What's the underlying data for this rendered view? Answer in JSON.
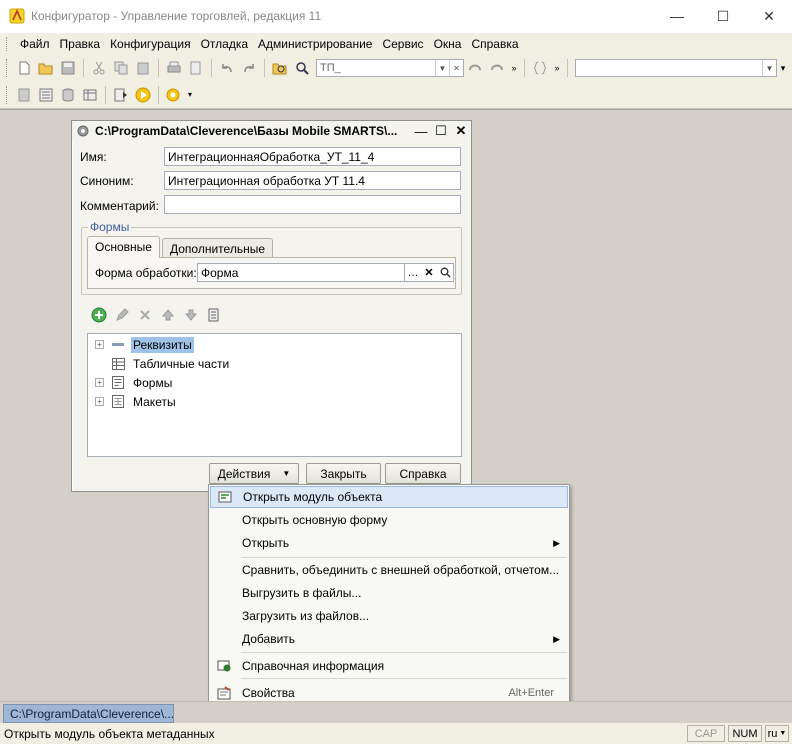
{
  "window": {
    "title": "Конфигуратор - Управление торговлей, редакция 11"
  },
  "menu": [
    "Файл",
    "Правка",
    "Конфигурация",
    "Отладка",
    "Администрирование",
    "Сервис",
    "Окна",
    "Справка"
  ],
  "toolbar": {
    "search_value": "ТП_"
  },
  "dialog": {
    "title": "C:\\ProgramData\\Cleverence\\Базы Mobile SMARTS\\...",
    "name_label": "Имя:",
    "name_value": "ИнтеграционнаяОбработка_УТ_11_4",
    "synonym_label": "Синоним:",
    "synonym_value": "Интеграционная обработка УТ 11.4",
    "comment_label": "Комментарий:",
    "comment_value": "",
    "forms_group_title": "Формы",
    "tabs": [
      "Основные",
      "Дополнительные"
    ],
    "form_label": "Форма обработки:",
    "form_value": "Форма",
    "tree": [
      {
        "label": "Реквизиты",
        "expand": "+",
        "selected": true
      },
      {
        "label": "Табличные части",
        "expand": "",
        "selected": false
      },
      {
        "label": "Формы",
        "expand": "+",
        "selected": false
      },
      {
        "label": "Макеты",
        "expand": "+",
        "selected": false
      }
    ],
    "actions_label": "Действия",
    "close_label": "Закрыть",
    "help_label": "Справка"
  },
  "context_menu": {
    "items": [
      {
        "label": "Открыть модуль объекта",
        "shortcut": "",
        "submenu": false,
        "icon": "module-icon"
      },
      {
        "label": "Открыть основную форму",
        "shortcut": "",
        "submenu": false,
        "icon": ""
      },
      {
        "label": "Открыть",
        "shortcut": "",
        "submenu": true,
        "icon": ""
      },
      {
        "label": "Сравнить, объединить с внешней обработкой, отчетом...",
        "shortcut": "",
        "submenu": false,
        "icon": ""
      },
      {
        "label": "Выгрузить в файлы...",
        "shortcut": "",
        "submenu": false,
        "icon": ""
      },
      {
        "label": "Загрузить из файлов...",
        "shortcut": "",
        "submenu": false,
        "icon": ""
      },
      {
        "label": "Добавить",
        "shortcut": "",
        "submenu": true,
        "icon": ""
      },
      {
        "label": "Справочная информация",
        "shortcut": "",
        "submenu": false,
        "icon": "help-info-icon"
      },
      {
        "label": "Свойства",
        "shortcut": "Alt+Enter",
        "submenu": false,
        "icon": "properties-icon"
      }
    ]
  },
  "taskbar": {
    "item_label": "C:\\ProgramData\\Cleverence\\..."
  },
  "status": {
    "text": "Открыть модуль объекта метаданных",
    "cap": "CAP",
    "num": "NUM",
    "lang": "ru"
  },
  "colors": {
    "selection": "#9fc3e8",
    "menu_highlight": "#dbe8f8",
    "workspace": "#d4d0c8"
  }
}
